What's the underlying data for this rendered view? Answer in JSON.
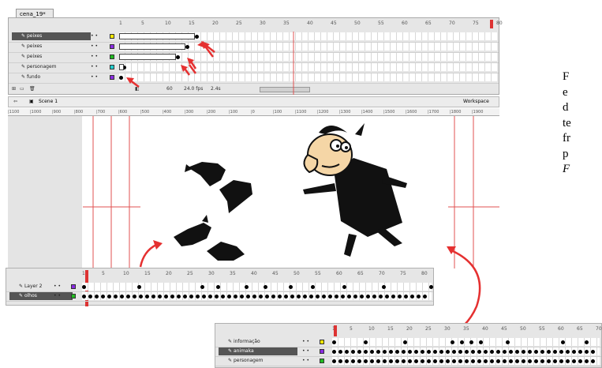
{
  "top_timeline": {
    "tab_label": "cena_19*",
    "layers": [
      {
        "name": "peixes",
        "color": "#f2e600",
        "selected": true
      },
      {
        "name": "peixes",
        "color": "#8a2be2",
        "selected": false
      },
      {
        "name": "peixes",
        "color": "#22bb22",
        "selected": false
      },
      {
        "name": "personagem",
        "color": "#22cccc",
        "selected": false
      },
      {
        "name": "fundo",
        "color": "#8a2be2",
        "selected": false
      }
    ],
    "frame_numbers": [
      "1",
      "5",
      "10",
      "15",
      "20",
      "25",
      "30",
      "35",
      "40",
      "45",
      "50",
      "55",
      "60",
      "65",
      "70",
      "75",
      "80"
    ],
    "fps": "24.0 fps",
    "time": "2.4s",
    "current_frame": "60"
  },
  "edit_bar": {
    "scene_label": "Scene 1",
    "workspace_label": "Workspace"
  },
  "ruler": [
    "|1100",
    "|1000",
    "|900",
    "|800",
    "|700",
    "|600",
    "|500",
    "|400",
    "|300",
    "|200",
    "|100",
    "|0",
    "|100",
    "|1100",
    "|1200",
    "|1300",
    "|1400",
    "|1500",
    "|1600",
    "|1700",
    "|1800",
    "|1900"
  ],
  "bottom_left_timeline": {
    "layers": [
      {
        "name": "Layer 2",
        "color": "#8a2be2",
        "selected": false
      },
      {
        "name": "olhos",
        "color": "#22bb22",
        "selected": true
      }
    ],
    "frame_numbers": [
      "1",
      "5",
      "10",
      "15",
      "20",
      "25",
      "30",
      "35",
      "40",
      "45",
      "50",
      "55",
      "60",
      "65",
      "70",
      "75",
      "80"
    ]
  },
  "bottom_right_timeline": {
    "layers": [
      {
        "name": "informação",
        "color": "#f2e600",
        "selected": false
      },
      {
        "name": "animaka",
        "color": "#8a2be2",
        "selected": true
      },
      {
        "name": "personagem",
        "color": "#22bb22",
        "selected": false
      }
    ],
    "frame_numbers": [
      "1",
      "5",
      "10",
      "15",
      "20",
      "25",
      "30",
      "35",
      "40",
      "45",
      "50",
      "55",
      "60",
      "65",
      "70"
    ]
  },
  "caption": {
    "lines": [
      "F",
      "e",
      "d",
      "te",
      "fr",
      "p",
      "F"
    ]
  },
  "colors": {
    "annotation_red": "#e53030",
    "panel_gray": "#e6e6e6",
    "selected_row": "#555555"
  }
}
